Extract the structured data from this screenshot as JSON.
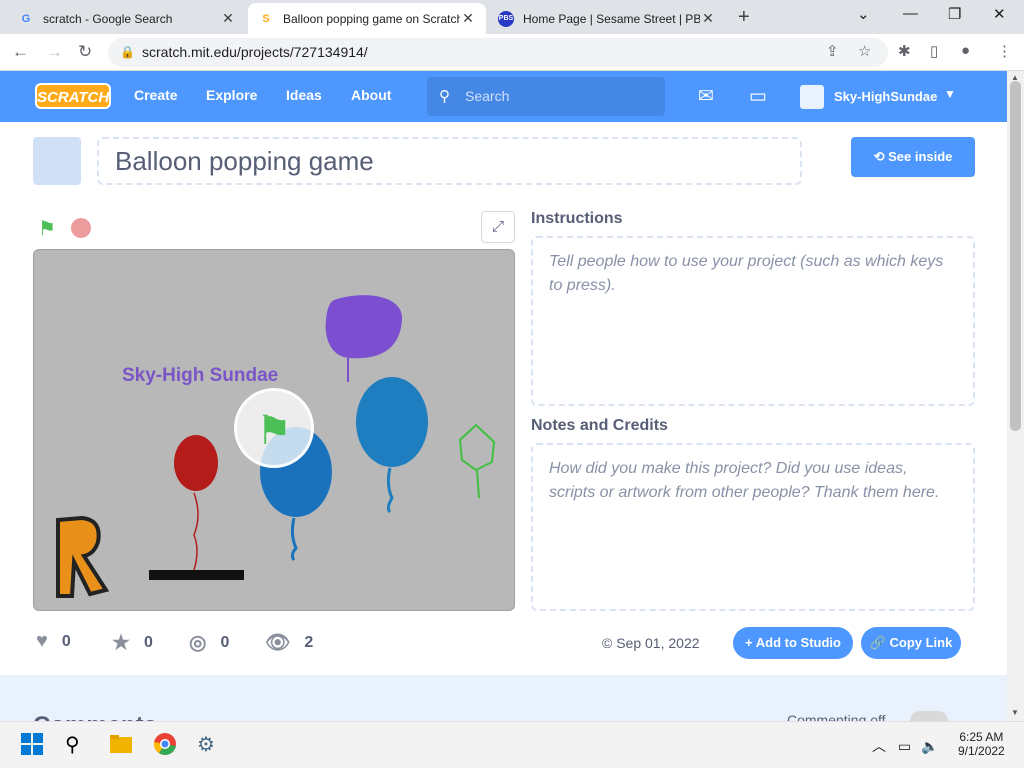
{
  "browser": {
    "tabs": [
      {
        "title": "scratch - Google Search",
        "favicon": "google-icon"
      },
      {
        "title": "Balloon popping game on Scratch",
        "favicon": "scratch-icon",
        "active": true
      },
      {
        "title": "Home Page | Sesame Street | PBS",
        "favicon": "pbs-icon"
      }
    ],
    "url": "scratch.mit.edu/projects/727134914/"
  },
  "nav": {
    "logo": "SCRATCH",
    "links": [
      "Create",
      "Explore",
      "Ideas",
      "About"
    ],
    "search_placeholder": "Search",
    "username": "Sky-HighSundae"
  },
  "project": {
    "title": "Balloon popping game",
    "see_inside": "See inside",
    "stage_text": "Sky-High Sundae",
    "instructions_title": "Instructions",
    "instructions_placeholder": "Tell people how to use your project (such as which keys to press).",
    "notes_title": "Notes and Credits",
    "notes_placeholder": "How did you make this project? Did you use ideas, scripts or artwork from other people? Thank them here.",
    "stats": {
      "loves": "0",
      "favorites": "0",
      "remixes": "0",
      "views": "2"
    },
    "date": "Sep 01, 2022",
    "add_to_studio": "Add to Studio",
    "copy_link": "Copy Link"
  },
  "comments": {
    "title": "Comments",
    "commenting_off": "Commenting off"
  },
  "taskbar": {
    "time": "6:25 AM",
    "date": "9/1/2022"
  },
  "colors": {
    "scratch_blue": "#4d97ff",
    "text": "#575e75"
  }
}
